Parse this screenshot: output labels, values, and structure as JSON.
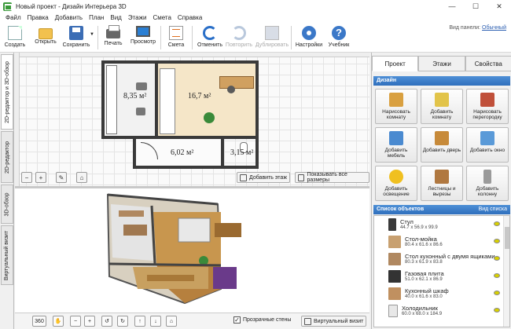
{
  "window": {
    "title": "Новый проект - Дизайн Интерьера 3D"
  },
  "menu": [
    "Файл",
    "Правка",
    "Добавить",
    "План",
    "Вид",
    "Этажи",
    "Смета",
    "Справка"
  ],
  "toolbar": {
    "create": "Создать",
    "open": "Открыть",
    "save": "Сохранить",
    "print": "Печать",
    "preview": "Просмотр",
    "estimate": "Смета",
    "undo": "Отменить",
    "redo": "Повторить",
    "duplicate": "Дублировать",
    "settings": "Настройки",
    "help": "Учебник",
    "panel_view_label": "Вид панели:",
    "panel_view_value": "Обычный"
  },
  "left_tabs": [
    "2D-редактор и 3D-обзор",
    "2D-редактор",
    "3D-обзор",
    "Виртуальный визит"
  ],
  "plan": {
    "rooms": [
      {
        "area": "8,35 м²"
      },
      {
        "area": "16,7 м²"
      },
      {
        "area": "6,02 м²"
      },
      {
        "area": "3,15 м²"
      }
    ],
    "add_floor": "Добавить этаж",
    "show_sizes": "Показывать все размеры"
  },
  "view3d": {
    "transparent_walls": "Прозрачные стены",
    "virtual_visit": "Виртуальный визит",
    "mode_360": "360"
  },
  "right_panel": {
    "tabs": [
      "Проект",
      "Этажи",
      "Свойства"
    ],
    "design_title": "Дизайн",
    "design_buttons": [
      {
        "label": "Нарисовать комнату",
        "icon": "pencil-room-icon",
        "color": "#d9a040"
      },
      {
        "label": "Добавить комнату",
        "icon": "add-room-icon",
        "color": "#e2c44a"
      },
      {
        "label": "Нарисовать перегородку",
        "icon": "brick-wall-icon",
        "color": "#c0503a"
      },
      {
        "label": "Добавить мебель",
        "icon": "chair-icon",
        "color": "#4a8ad0"
      },
      {
        "label": "Добавить дверь",
        "icon": "door-icon",
        "color": "#c78a3a"
      },
      {
        "label": "Добавить окно",
        "icon": "window-icon",
        "color": "#5a9ad8"
      },
      {
        "label": "Добавить освещение",
        "icon": "bulb-icon",
        "color": "#f0c020"
      },
      {
        "label": "Лестницы и вырезы",
        "icon": "stairs-icon",
        "color": "#b07840"
      },
      {
        "label": "Добавить колонну",
        "icon": "column-icon",
        "color": "#9a9a9a"
      }
    ],
    "objects_title": "Список объектов",
    "objects_view": "Вид списка",
    "objects": [
      {
        "name": "Стул",
        "dims": "44.7 x 56.9 x 99.9",
        "color": "#3a3a3a"
      },
      {
        "name": "Стол-мойка",
        "dims": "80.4 x 61.6 x 86.6",
        "color": "#c8a070"
      },
      {
        "name": "Стол кухонный с двумя ящиками",
        "dims": "80.3 x 61.9 x 83.8",
        "color": "#b08860"
      },
      {
        "name": "Газовая плита",
        "dims": "51.0 x 62.1 x 86.9",
        "color": "#333333"
      },
      {
        "name": "Кухонный шкаф",
        "dims": "40.0 x 61.6 x 83.0",
        "color": "#c09060"
      },
      {
        "name": "Холодильник",
        "dims": "60.0 x 68.0 x 184.9",
        "color": "#e8e8e8"
      }
    ]
  }
}
